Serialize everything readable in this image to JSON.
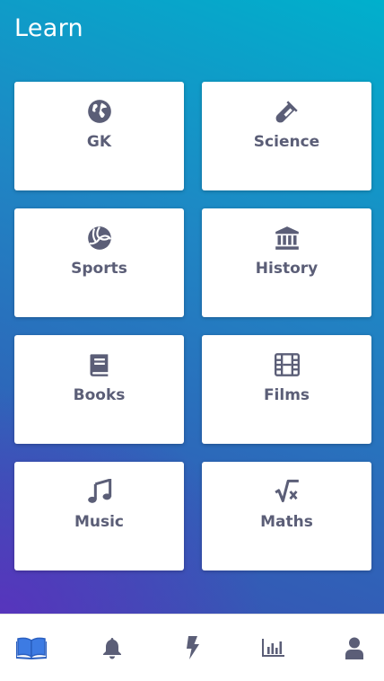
{
  "header": {
    "title": "Learn"
  },
  "colors": {
    "card_text": "#5b5e77",
    "nav_active": "#3d7be3",
    "nav_inactive": "#5b5e77"
  },
  "categories": [
    {
      "label": "GK",
      "icon": "globe-icon"
    },
    {
      "label": "Science",
      "icon": "flask-icon"
    },
    {
      "label": "Sports",
      "icon": "volleyball-icon"
    },
    {
      "label": "History",
      "icon": "landmark-icon"
    },
    {
      "label": "Books",
      "icon": "book-icon"
    },
    {
      "label": "Films",
      "icon": "film-icon"
    },
    {
      "label": "Music",
      "icon": "music-icon"
    },
    {
      "label": "Maths",
      "icon": "square-root-icon"
    }
  ],
  "nav": [
    {
      "icon": "open-book-icon",
      "active": true
    },
    {
      "icon": "bell-icon",
      "active": false
    },
    {
      "icon": "lightning-icon",
      "active": false
    },
    {
      "icon": "bar-chart-icon",
      "active": false
    },
    {
      "icon": "user-icon",
      "active": false
    }
  ]
}
